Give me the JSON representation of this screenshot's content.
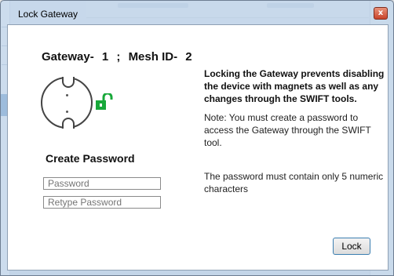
{
  "window": {
    "title": "Lock Gateway",
    "close_glyph": "x"
  },
  "gateway": {
    "gateway_label": "Gateway-",
    "gateway_value": "1",
    "separator": ";",
    "mesh_label": "Mesh ID-",
    "mesh_value": "2"
  },
  "info": {
    "warning": "Locking the Gateway prevents disabling the device with magnets as well as any changes through the SWIFT tools.",
    "note": "Note: You must create a password to access the Gateway through the SWIFT tool."
  },
  "create_password": {
    "title": "Create Password",
    "rule": "The password must contain only 5 numeric characters",
    "password_placeholder": "Password",
    "retype_placeholder": "Retype Password"
  },
  "actions": {
    "lock_label": "Lock"
  },
  "colors": {
    "padlock": "#18a83a",
    "accent_border": "#3c7fb1"
  },
  "icons": {
    "device": "gateway-device-icon",
    "padlock": "unlocked-padlock-icon",
    "close": "close-icon"
  }
}
